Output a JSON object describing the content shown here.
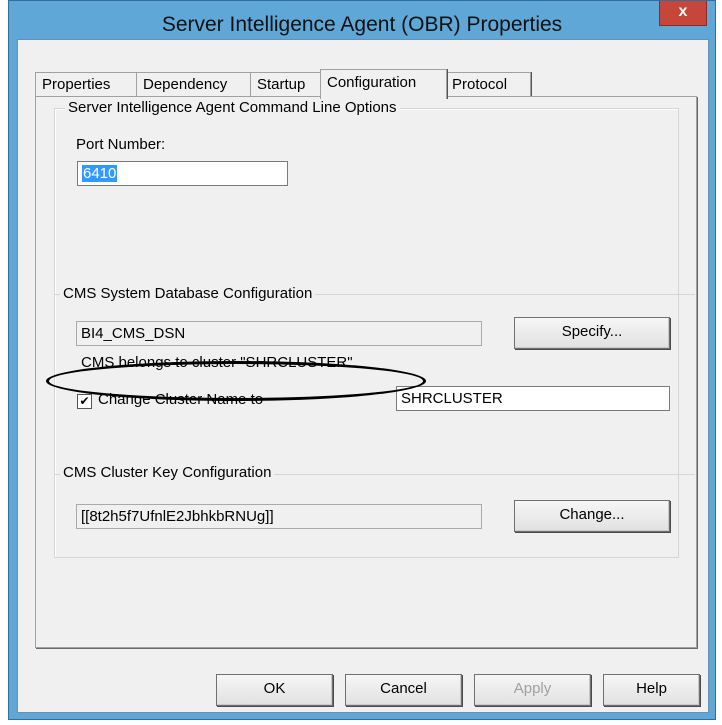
{
  "window": {
    "title": "Server Intelligence Agent (OBR) Properties",
    "close_label": "x"
  },
  "tabs": [
    {
      "label": "Properties"
    },
    {
      "label": "Dependency"
    },
    {
      "label": "Startup"
    },
    {
      "label": "Configuration",
      "active": true
    },
    {
      "label": "Protocol"
    }
  ],
  "sia": {
    "group_label": "Server Intelligence Agent Command Line Options",
    "port_label": "Port Number:",
    "port_value": "6410"
  },
  "cms": {
    "group_label": "CMS System Database Configuration",
    "dsn_value": "BI4_CMS_DSN",
    "specify_label": "Specify...",
    "cluster_message": "CMS belongs to cluster \"SHRCLUSTER\".",
    "change_cluster_label": "Change Cluster Name to",
    "change_cluster_checked": true,
    "cluster_name_value": "SHRCLUSTER"
  },
  "cluster_key": {
    "group_label": "CMS Cluster Key Configuration",
    "key_value": "[[8t2h5f7UfnlE2JbhkbRNUg]]",
    "change_label": "Change..."
  },
  "footer": {
    "ok_label": "OK",
    "cancel_label": "Cancel",
    "apply_label": "Apply",
    "help_label": "Help"
  },
  "colors": {
    "frame": "#5fa7d6",
    "close_button": "#c7463a",
    "selection": "#3399ff"
  }
}
